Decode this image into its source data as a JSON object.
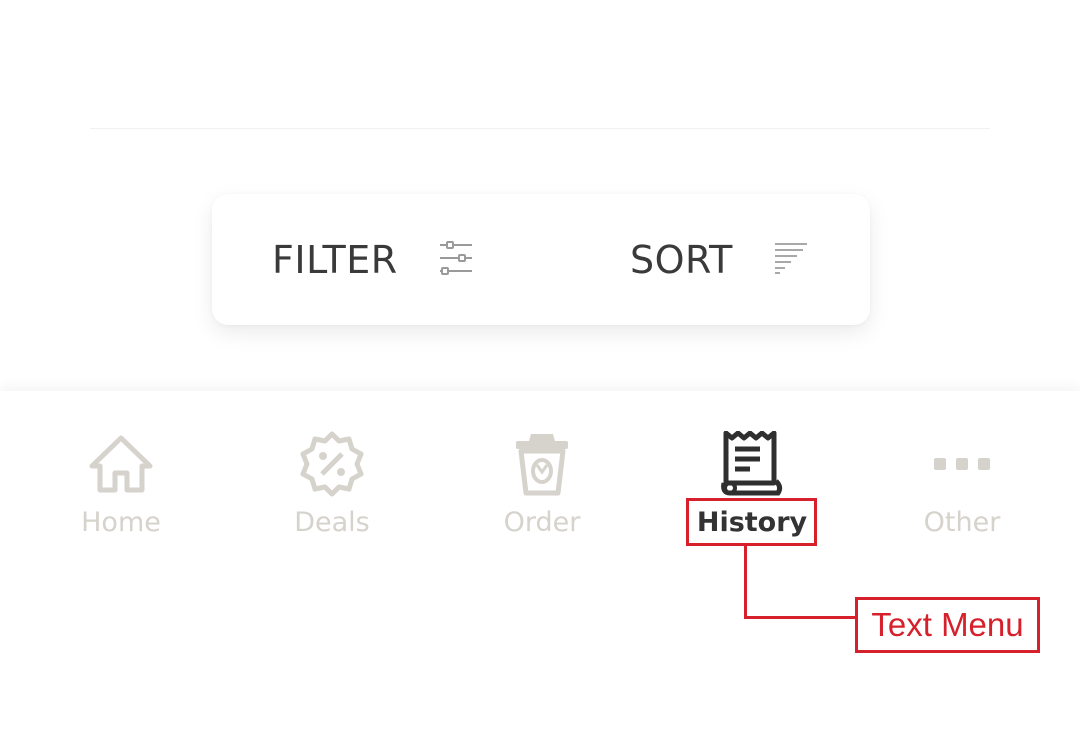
{
  "toolbar": {
    "filter_label": "FILTER",
    "filter_icon": "sliders-icon",
    "sort_label": "SORT",
    "sort_icon": "sort-lines-icon"
  },
  "nav": {
    "items": [
      {
        "label": "Home",
        "icon": "home-icon",
        "active": false
      },
      {
        "label": "Deals",
        "icon": "discount-badge-icon",
        "active": false
      },
      {
        "label": "Order",
        "icon": "coffee-cup-icon",
        "active": false
      },
      {
        "label": "History",
        "icon": "receipt-scroll-icon",
        "active": true
      },
      {
        "label": "Other",
        "icon": "more-dots-icon",
        "active": false
      }
    ],
    "inactive_color": "#d6d2cc",
    "active_color": "#333333"
  },
  "annotation": {
    "label": "Text Menu",
    "color": "#d6202c"
  }
}
